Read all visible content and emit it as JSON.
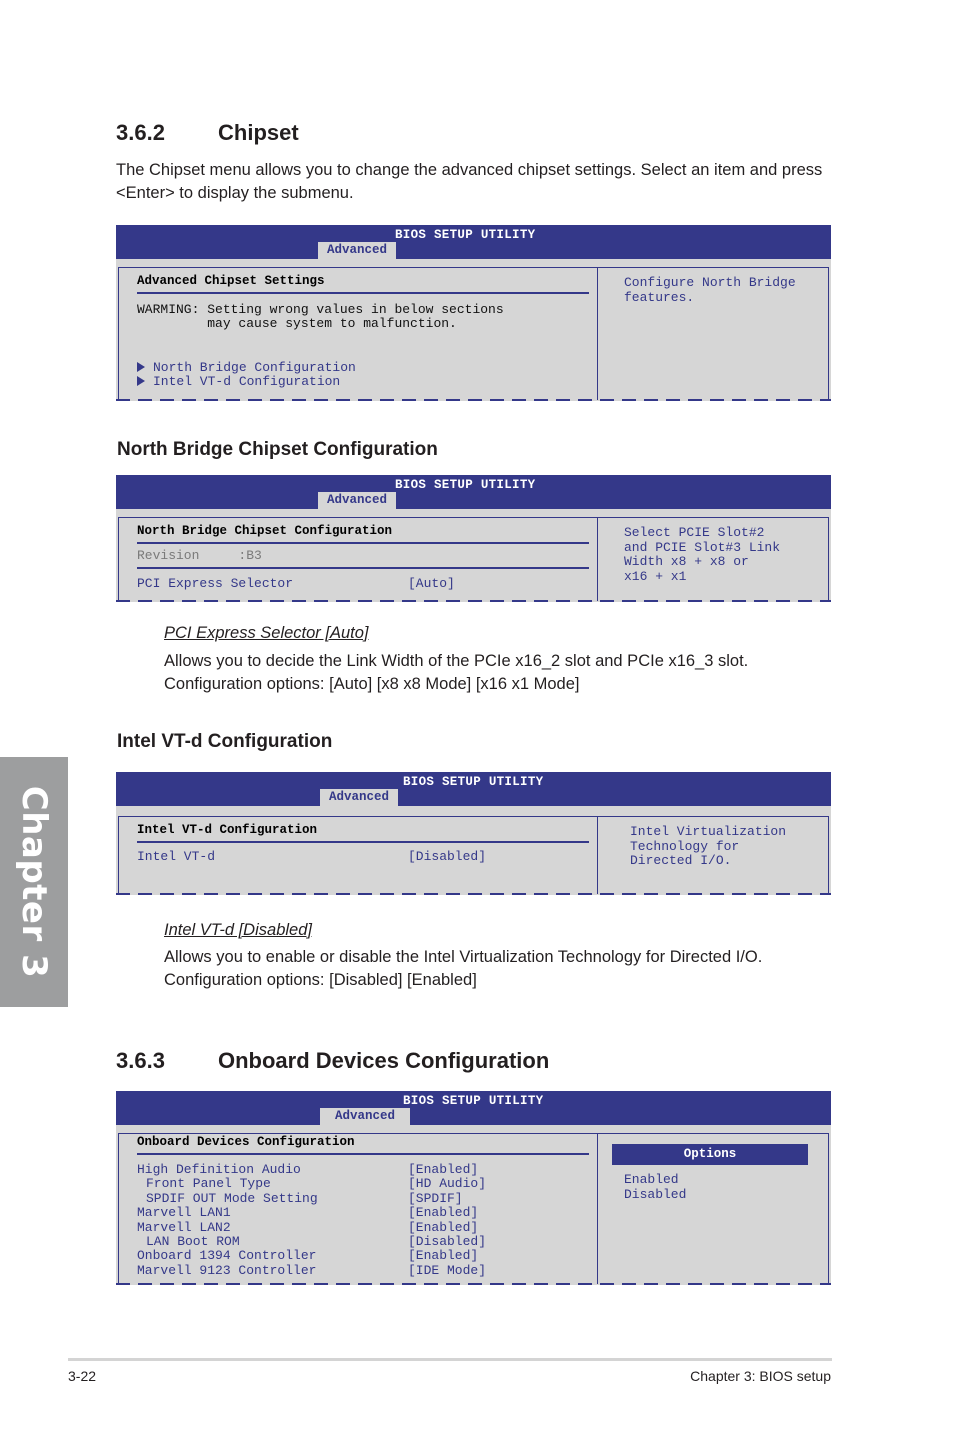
{
  "side_tab": {
    "label": "Chapter 3"
  },
  "section_362": {
    "number": "3.6.2",
    "title": "Chipset",
    "intro": "The Chipset menu allows you to change the advanced chipset settings. Select an item and press <Enter> to display the submenu.",
    "bios": {
      "header_title": "BIOS SETUP UTILITY",
      "tab": "Advanced",
      "heading": "Advanced Chipset Settings",
      "warning_line1": "WARMING: Setting wrong values in below sections",
      "warning_line2": "         may cause system to malfunction.",
      "submenus": [
        "North Bridge Configuration",
        "Intel VT-d Configuration"
      ],
      "help": "Configure North Bridge\nfeatures."
    }
  },
  "north_bridge": {
    "title": "North Bridge Chipset Configuration",
    "bios": {
      "header_title": "BIOS SETUP UTILITY",
      "tab": "Advanced",
      "heading": "North Bridge Chipset Configuration",
      "revision_label": "Revision     :B3",
      "item_label": "PCI Express Selector",
      "item_value": "[Auto]",
      "help": "Select PCIE Slot#2\nand PCIE Slot#3 Link\nWidth x8 + x8 or\nx16 + x1"
    },
    "item_title": "PCI Express Selector [Auto]",
    "item_desc": "Allows you to decide the Link Width of the PCIe x16_2 slot and PCIe x16_3 slot.",
    "item_options": "Configuration options: [Auto] [x8 x8 Mode] [x16 x1 Mode]"
  },
  "vtd": {
    "title": "Intel VT-d Configuration",
    "bios": {
      "header_title": "BIOS SETUP UTILITY",
      "tab": "Advanced",
      "heading": "Intel VT-d Configuration",
      "item_label": "Intel VT-d",
      "item_value": "[Disabled]",
      "help": "Intel Virtualization\nTechnology for\nDirected I/O."
    },
    "item_title": "Intel VT-d [Disabled]",
    "item_desc": "Allows you to enable or disable the Intel Virtualization Technology for Directed I/O.",
    "item_options": "Configuration options: [Disabled] [Enabled]"
  },
  "section_363": {
    "number": "3.6.3",
    "title": "Onboard Devices Configuration",
    "bios": {
      "header_title": "BIOS SETUP UTILITY",
      "tab": "Advanced",
      "heading": "Onboard Devices Configuration",
      "items": [
        {
          "label": "High Definition Audio",
          "value": "[Enabled]",
          "indent": false
        },
        {
          "label": "Front Panel Type",
          "value": "[HD Audio]",
          "indent": true
        },
        {
          "label": "SPDIF OUT Mode Setting",
          "value": "[SPDIF]",
          "indent": true
        },
        {
          "label": "Marvell LAN1",
          "value": "[Enabled]",
          "indent": false
        },
        {
          "label": "Marvell LAN2",
          "value": "[Enabled]",
          "indent": false
        },
        {
          "label": "LAN Boot ROM",
          "value": "[Disabled]",
          "indent": true
        },
        {
          "label": "Onboard 1394 Controller",
          "value": "[Enabled]",
          "indent": false
        },
        {
          "label": "Marvell 9123 Controller",
          "value": "[IDE Mode]",
          "indent": false
        }
      ],
      "options_header": "Options",
      "options": [
        "Enabled",
        "Disabled"
      ]
    }
  },
  "footer": {
    "page": "3-22",
    "chapter": "Chapter 3: BIOS setup"
  }
}
